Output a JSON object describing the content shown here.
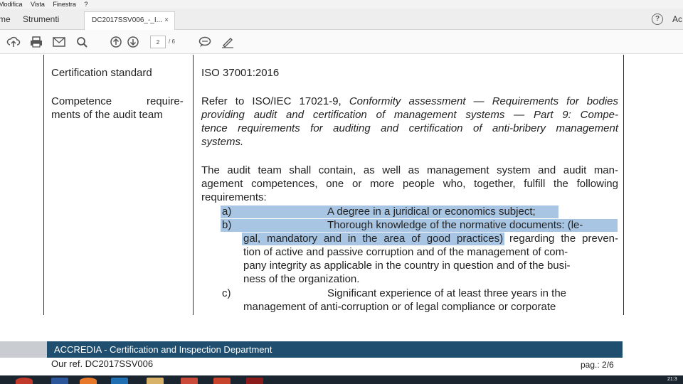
{
  "menubar": {
    "items": [
      "Modifica",
      "Vista",
      "Finestra",
      "?"
    ]
  },
  "tabs": {
    "home_label": "me",
    "tools_label": "Strumenti",
    "doc_tab_label": "DC2017SSV006_-_I...",
    "doc_tab_close": "×",
    "help_glyph": "?",
    "signin_label": "Ac"
  },
  "toolbar": {
    "page_current": "2",
    "page_total": "/ 6",
    "icons": [
      "upload-icon",
      "print-icon",
      "email-icon",
      "search-icon",
      "page-up-icon",
      "page-down-icon",
      "comment-icon",
      "sign-icon"
    ]
  },
  "document": {
    "row1_label": "Certification standard",
    "row1_value": "ISO 37001:2016",
    "row2_label_line1_a": "Competence",
    "row2_label_line1_b": "require-",
    "row2_label_line2": "ments of the audit team",
    "ref_line1_plain": "Refer to ISO/IEC 17021-9, ",
    "ref_line1_italic": "Conformity assessment — Requirements for bodies",
    "ref_line2": "providing audit and certification of management systems — Part 9: Compe-",
    "ref_line3": "tence requirements for auditing and certification of anti-bribery management",
    "ref_line4": "systems.",
    "team_line1": "The audit team shall contain, as well as management system and audit man-",
    "team_line2": "agement competences, one or more people who, together, fulfill the following",
    "team_line3": "requirements:",
    "item_a_marker": "a)",
    "item_a_text": "A degree in a juridical or economics subject;",
    "item_b_marker": "b)",
    "item_b_line1": "Thorough knowledge of the normative documents: (le-",
    "item_b_line2_highlighted": "gal, mandatory and in the area of good practices)",
    "item_b_line2_rest": " regarding the preven-",
    "item_b_line3": "tion of active and passive corruption and of the management of com-",
    "item_b_line4": "pany integrity as applicable in the country in question and of the busi-",
    "item_b_line5": "ness of the organization.",
    "item_c_marker": "c)",
    "item_c_line1": "Significant experience of at least three years in the",
    "item_c_line2": "management of anti-corruption or of legal compliance or corporate"
  },
  "footer": {
    "department": "ACCREDIA - Certification and Inspection Department",
    "our_ref": "Our ref. DC2017SSV006",
    "page_label": "pag.: 2/6"
  },
  "taskbar": {
    "clock": "21:3"
  },
  "colors": {
    "highlight": "#a8c6e4",
    "band_blue": "#1f4e6e",
    "band_grey": "#c9ccd0"
  }
}
